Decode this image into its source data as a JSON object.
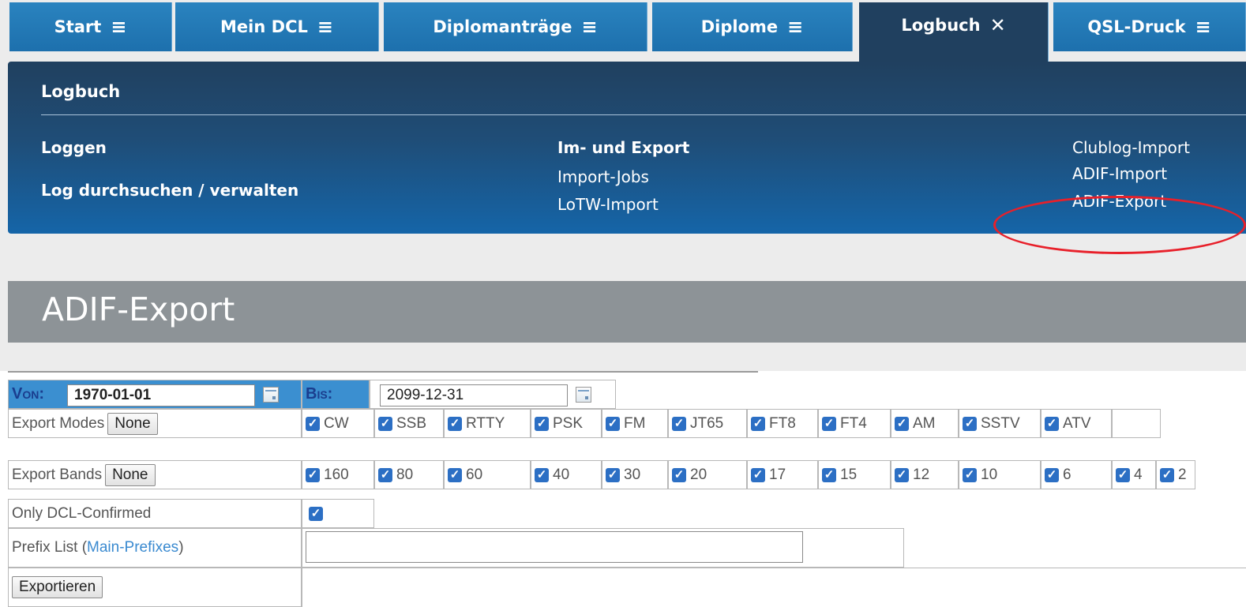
{
  "tabs": [
    {
      "label": "Start",
      "icon": "hamburger-icon"
    },
    {
      "label": "Mein DCL",
      "icon": "hamburger-icon"
    },
    {
      "label": "Diplomanträge",
      "icon": "hamburger-icon"
    },
    {
      "label": "Diplome",
      "icon": "hamburger-icon"
    },
    {
      "label": "Logbuch",
      "icon": "close-icon"
    },
    {
      "label": "QSL-Druck",
      "icon": "hamburger-icon"
    }
  ],
  "menu": {
    "title": "Logbuch",
    "loggen": "Loggen",
    "log_search": "Log durchsuchen / verwalten",
    "im_export": "Im- und Export",
    "import_jobs": "Import-Jobs",
    "lotw_import": "LoTW-Import",
    "clublog_import": "Clublog-Import",
    "adif_import": "ADIF-Import",
    "adif_export": "ADIF-Export"
  },
  "page": {
    "heading": "ADIF-Export"
  },
  "form": {
    "von_label": "Von:",
    "von_value": "1970-01-01",
    "bis_label": "Bis:",
    "bis_value": "2099-12-31",
    "modes_label": "Export Modes",
    "modes_button": "None",
    "modes": [
      "CW",
      "SSB",
      "RTTY",
      "PSK",
      "FM",
      "JT65",
      "FT8",
      "FT4",
      "AM",
      "SSTV",
      "ATV"
    ],
    "bands_label": "Export Bands",
    "bands_button": "None",
    "bands": [
      "160",
      "80",
      "60",
      "40",
      "30",
      "20",
      "17",
      "15",
      "12",
      "10",
      "6",
      "4",
      "2"
    ],
    "confirmed_label": "Only DCL-Confirmed",
    "prefix_label": "Prefix List (",
    "prefix_link": "Main-Prefixes",
    "prefix_close": ")",
    "prefix_value": "",
    "submit": "Exportieren"
  },
  "colors": {
    "tab_blue": "#1d70ad",
    "tab_active": "#20405f",
    "highlight_ellipse": "#e8202a",
    "von_bis_bg": "#3b8fd0"
  }
}
